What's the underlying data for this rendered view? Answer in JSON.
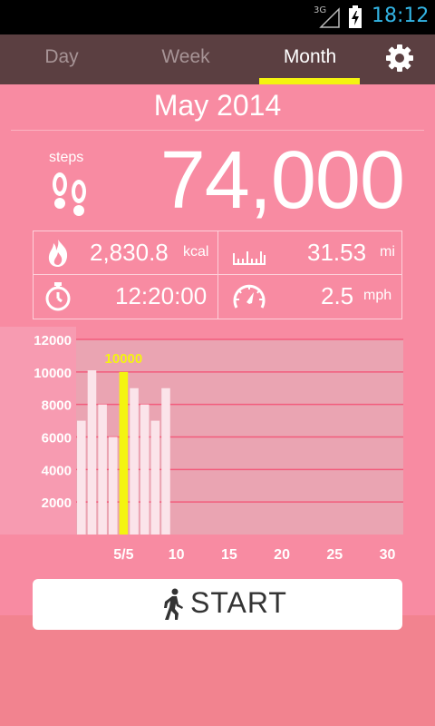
{
  "status_bar": {
    "network": "3G",
    "time": "18:12"
  },
  "tabs": [
    {
      "label": "Day",
      "active": false
    },
    {
      "label": "Week",
      "active": false
    },
    {
      "label": "Month",
      "active": true
    }
  ],
  "header": {
    "title": "May 2014"
  },
  "steps": {
    "label": "steps",
    "value": "74,000"
  },
  "stats": {
    "calories": {
      "value": "2,830.8",
      "unit": "kcal",
      "icon": "flame-icon"
    },
    "distance": {
      "value": "31.53",
      "unit": "mi",
      "icon": "ruler-icon"
    },
    "duration": {
      "value": "12:20:00",
      "icon": "stopwatch-icon"
    },
    "speed": {
      "value": "2.5",
      "unit": "mph",
      "icon": "speedometer-icon"
    }
  },
  "chart_data": {
    "type": "bar",
    "days": [
      1,
      2,
      3,
      4,
      5,
      6,
      7,
      8,
      9
    ],
    "values": [
      7000,
      10100,
      8000,
      6000,
      10000,
      9000,
      8000,
      7000,
      9000
    ],
    "highlight_index": 4,
    "highlight_label": "10000",
    "y_ticks": [
      2000,
      4000,
      6000,
      8000,
      10000,
      12000
    ],
    "y_tick_labels": [
      "2000",
      "4000",
      "6000",
      "8000",
      "10000",
      "12000"
    ],
    "x_ticks": [
      "5/5",
      "10",
      "15",
      "20",
      "25",
      "30"
    ],
    "x_tick_days": [
      5,
      10,
      15,
      20,
      25,
      30
    ],
    "ylim": [
      0,
      12000
    ],
    "xlim": [
      0,
      31
    ],
    "colors": {
      "bar": "#fbe4ea",
      "highlight": "#f4f410",
      "highlight_label": "#f4f410",
      "grid": "#f25c7c",
      "plot_bg": "#eaa4b2"
    }
  },
  "start_button": {
    "label": "START"
  },
  "colors": {
    "tab_bg": "#5b3f41",
    "tab_active_underline": "#f4f410",
    "card_bg": "#f88ba2"
  }
}
